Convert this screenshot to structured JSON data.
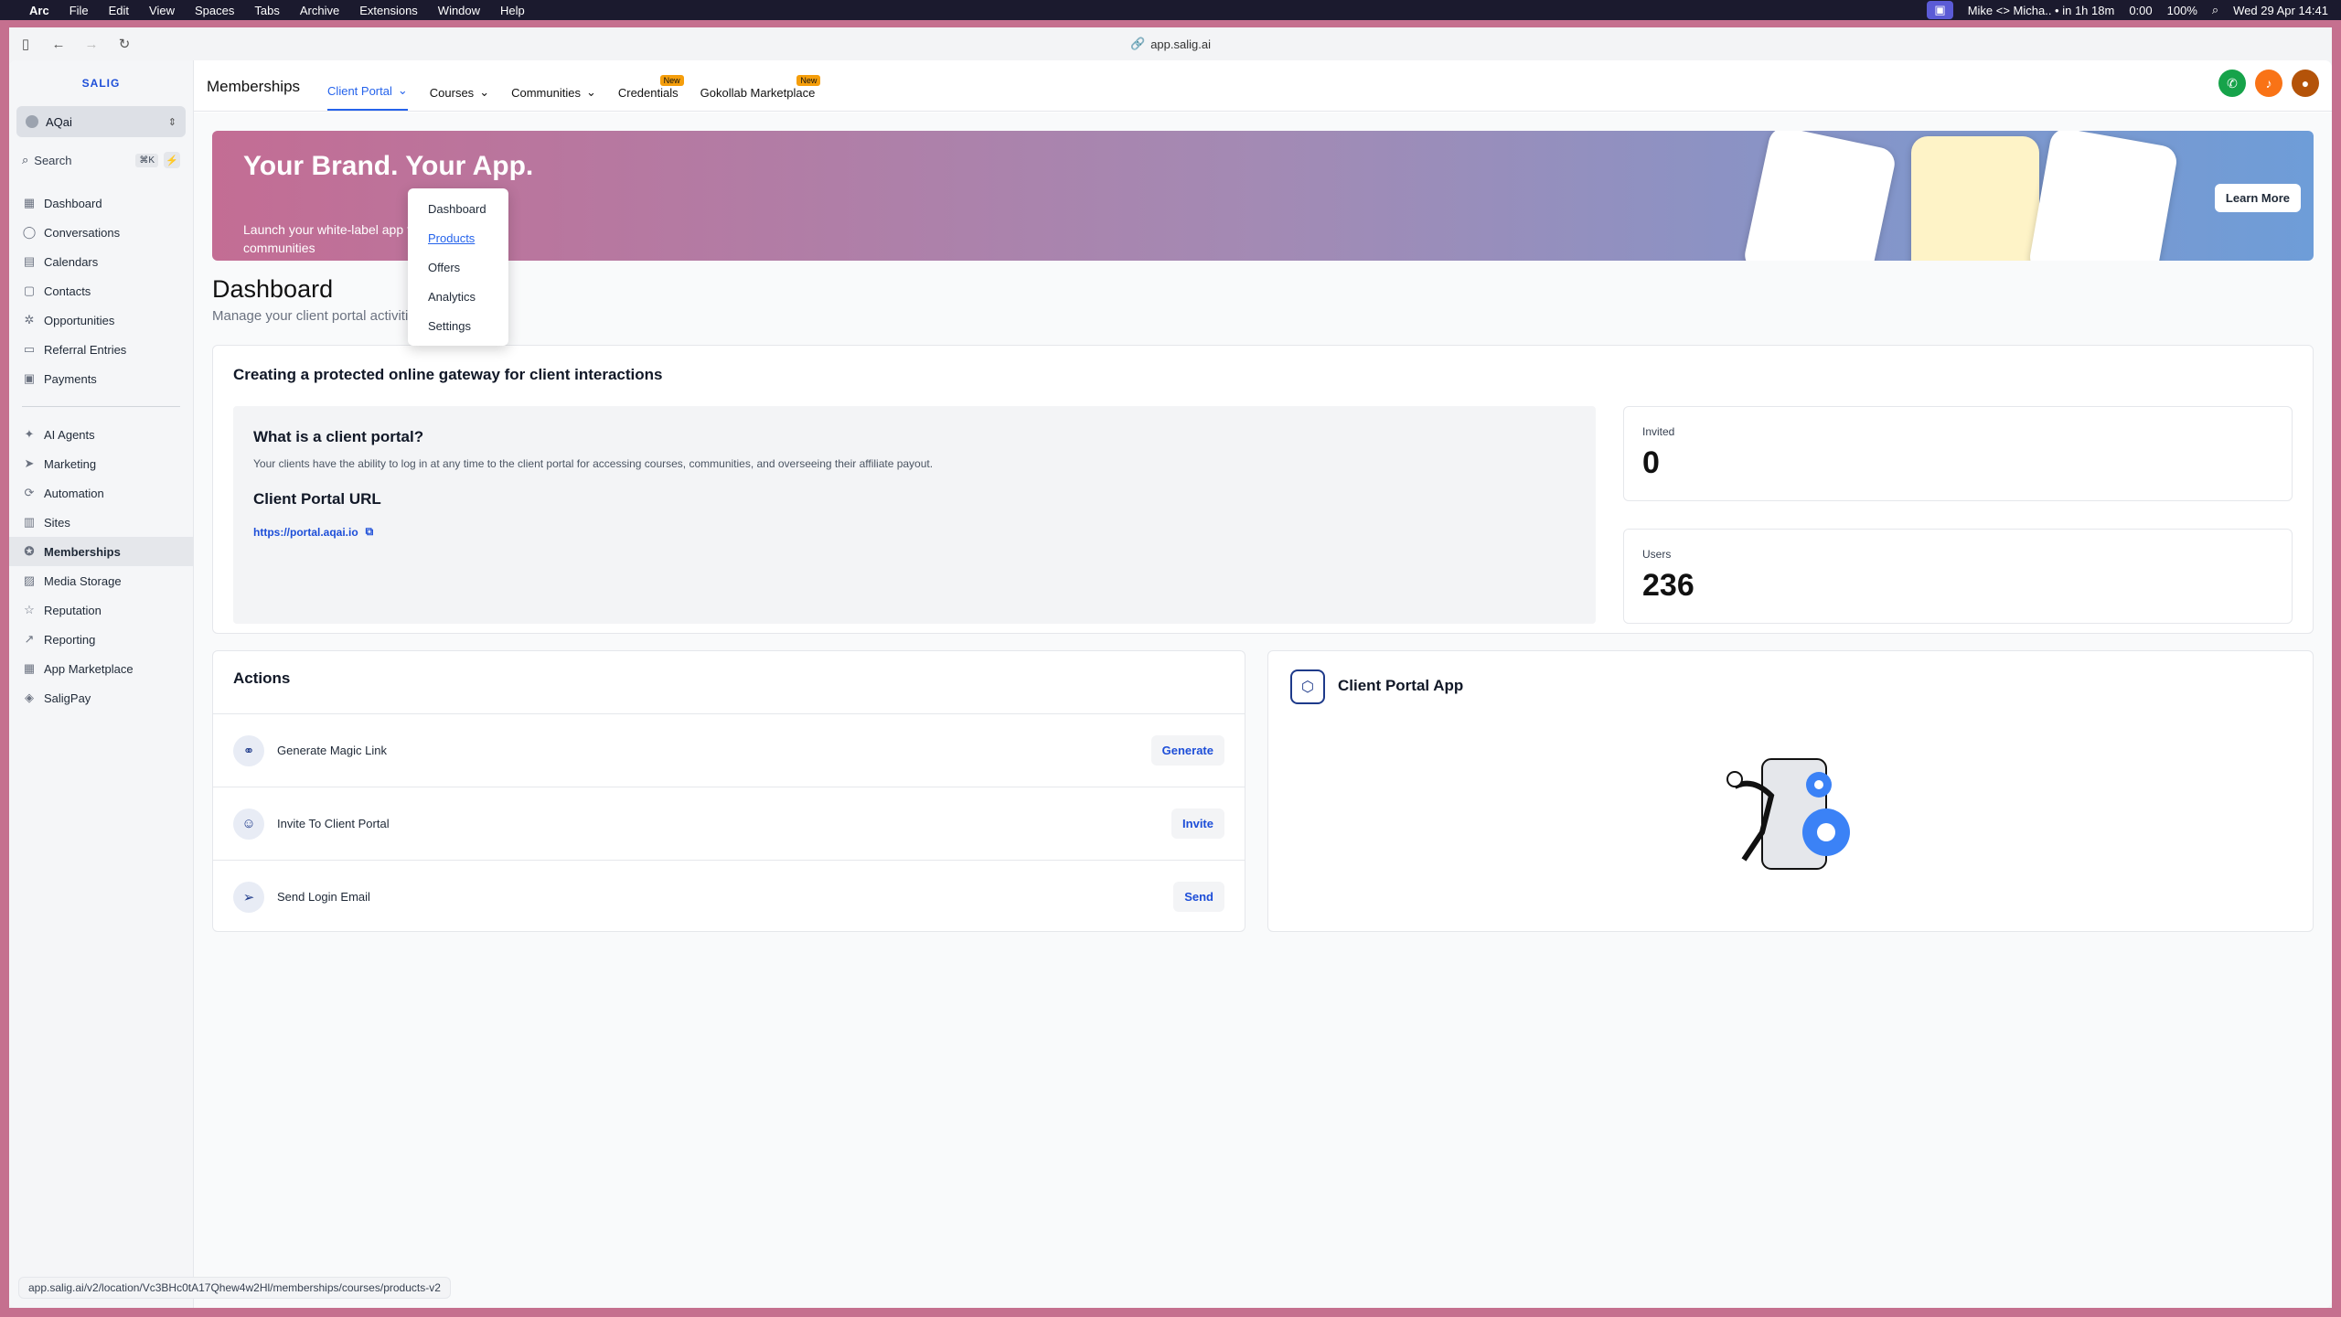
{
  "menubar": {
    "apple": "",
    "items": [
      "Arc",
      "File",
      "Edit",
      "View",
      "Spaces",
      "Tabs",
      "Archive",
      "Extensions",
      "Window",
      "Help"
    ],
    "meeting": "Mike <> Micha.. • in 1h 18m",
    "timer": "0:00",
    "battery": "100%",
    "datetime": "Wed 29 Apr  14:41"
  },
  "browser": {
    "url": "app.salig.ai"
  },
  "sidebar": {
    "logo": "SALIG",
    "account": "AQai",
    "search_placeholder": "Search",
    "search_shortcut": "⌘K",
    "items_primary": [
      {
        "label": "Dashboard",
        "icon": "grid-icon"
      },
      {
        "label": "Conversations",
        "icon": "chat-icon"
      },
      {
        "label": "Calendars",
        "icon": "calendar-icon"
      },
      {
        "label": "Contacts",
        "icon": "contacts-icon"
      },
      {
        "label": "Opportunities",
        "icon": "opportunities-icon"
      },
      {
        "label": "Referral Entries",
        "icon": "referral-icon"
      },
      {
        "label": "Payments",
        "icon": "payments-icon"
      }
    ],
    "items_secondary": [
      {
        "label": "AI Agents",
        "icon": "sparkle-icon"
      },
      {
        "label": "Marketing",
        "icon": "send-icon"
      },
      {
        "label": "Automation",
        "icon": "automation-icon"
      },
      {
        "label": "Sites",
        "icon": "sites-icon"
      },
      {
        "label": "Memberships",
        "icon": "membership-icon",
        "active": true
      },
      {
        "label": "Media Storage",
        "icon": "image-icon"
      },
      {
        "label": "Reputation",
        "icon": "star-icon"
      },
      {
        "label": "Reporting",
        "icon": "chart-icon"
      },
      {
        "label": "App Marketplace",
        "icon": "apps-icon"
      },
      {
        "label": "SaligPay",
        "icon": "pay-icon"
      }
    ]
  },
  "topnav": {
    "title": "Memberships",
    "tabs": [
      {
        "label": "Client Portal",
        "active": true,
        "chevron": true
      },
      {
        "label": "Courses",
        "chevron": true
      },
      {
        "label": "Communities",
        "chevron": true
      },
      {
        "label": "Credentials",
        "badge": "New"
      },
      {
        "label": "Gokollab Marketplace",
        "badge": "New"
      }
    ]
  },
  "dropdown": {
    "items": [
      "Dashboard",
      "Products",
      "Offers",
      "Analytics",
      "Settings"
    ],
    "hovered": "Products"
  },
  "banner": {
    "headline": "Your Brand. Your App.",
    "sub": "Launch your white-label app for courses and communities",
    "cta": "Learn More"
  },
  "dashboard": {
    "title": "Dashboard",
    "subtitle": "Manage your client portal activities"
  },
  "gateway": {
    "title": "Creating a protected online gateway for client interactions",
    "question": "What is a client portal?",
    "description": "Your clients have the ability to log in at any time to the client portal for accessing courses, communities, and overseeing their affiliate payout.",
    "url_heading": "Client Portal URL",
    "url": "https://portal.aqai.io"
  },
  "stats": {
    "invited_label": "Invited",
    "invited_value": "0",
    "users_label": "Users",
    "users_value": "236"
  },
  "actions": {
    "title": "Actions",
    "rows": [
      {
        "label": "Generate Magic Link",
        "button": "Generate",
        "icon": "magic-link-icon"
      },
      {
        "label": "Invite To Client Portal",
        "button": "Invite",
        "icon": "invite-user-icon"
      },
      {
        "label": "Send Login Email",
        "button": "Send",
        "icon": "paper-plane-icon"
      }
    ]
  },
  "client_app": {
    "title": "Client Portal App"
  },
  "statusbar": {
    "url": "app.salig.ai/v2/location/Vc3BHc0tA17Qhew4w2Hl/memberships/courses/products-v2"
  },
  "colors": {
    "accent": "#2563eb",
    "frame": "#c5708f",
    "badge": "#f59e0b"
  }
}
